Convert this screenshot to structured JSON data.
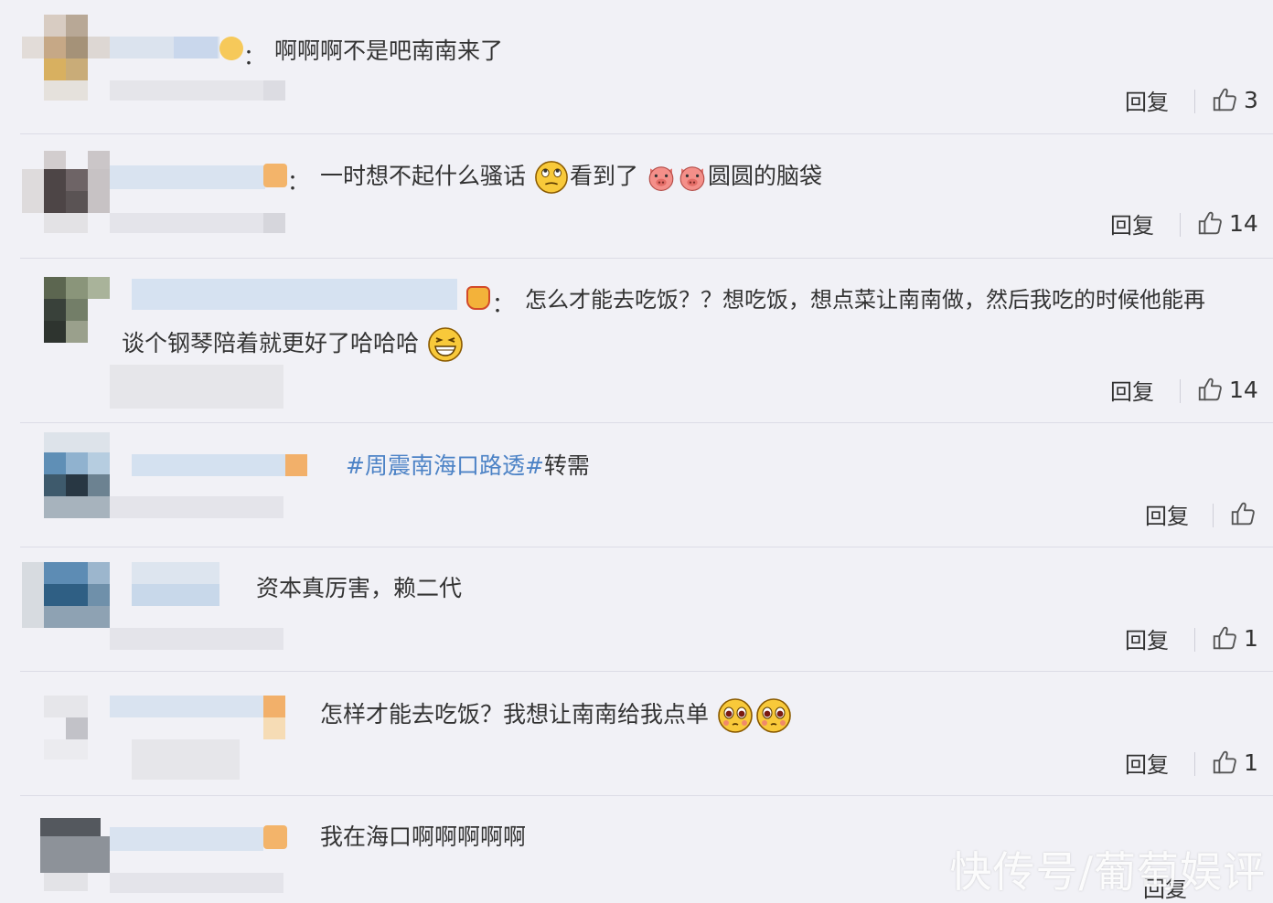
{
  "comments": [
    {
      "text": "啊啊啊不是吧南南来了",
      "reply": "回复",
      "likes": "3"
    },
    {
      "text_parts": [
        "一时想不起什么骚话",
        "看到了",
        "圆圆的脑袋"
      ],
      "reply": "回复",
      "likes": "14"
    },
    {
      "text_line1": "怎么才能去吃饭？？想吃饭，想点菜让南南做，然后我吃的时候他能再",
      "text_line2": "谈个钢琴陪着就更好了哈哈哈",
      "reply": "回复",
      "likes": "14"
    },
    {
      "tag": "#周震南海口路透#",
      "text": "转需",
      "reply": "回复",
      "likes": ""
    },
    {
      "text": "资本真厉害，赖二代",
      "reply": "回复",
      "likes": "1"
    },
    {
      "text": "怎样才能去吃饭？我想让南南给我点单",
      "reply": "回复",
      "likes": "1"
    },
    {
      "text": "我在海口啊啊啊啊啊",
      "reply": "回复",
      "likes": ""
    }
  ],
  "colon": "：",
  "watermark": "快传号/葡萄娱评",
  "icons": {
    "like": "thumbs-up-icon",
    "vip": "vip-crown-icon",
    "emoji_rolleyes": "eye-roll-emoji-icon",
    "emoji_pig": "pig-face-emoji-icon",
    "emoji_grin": "grin-emoji-icon",
    "emoji_pleading": "pleading-emoji-icon"
  }
}
